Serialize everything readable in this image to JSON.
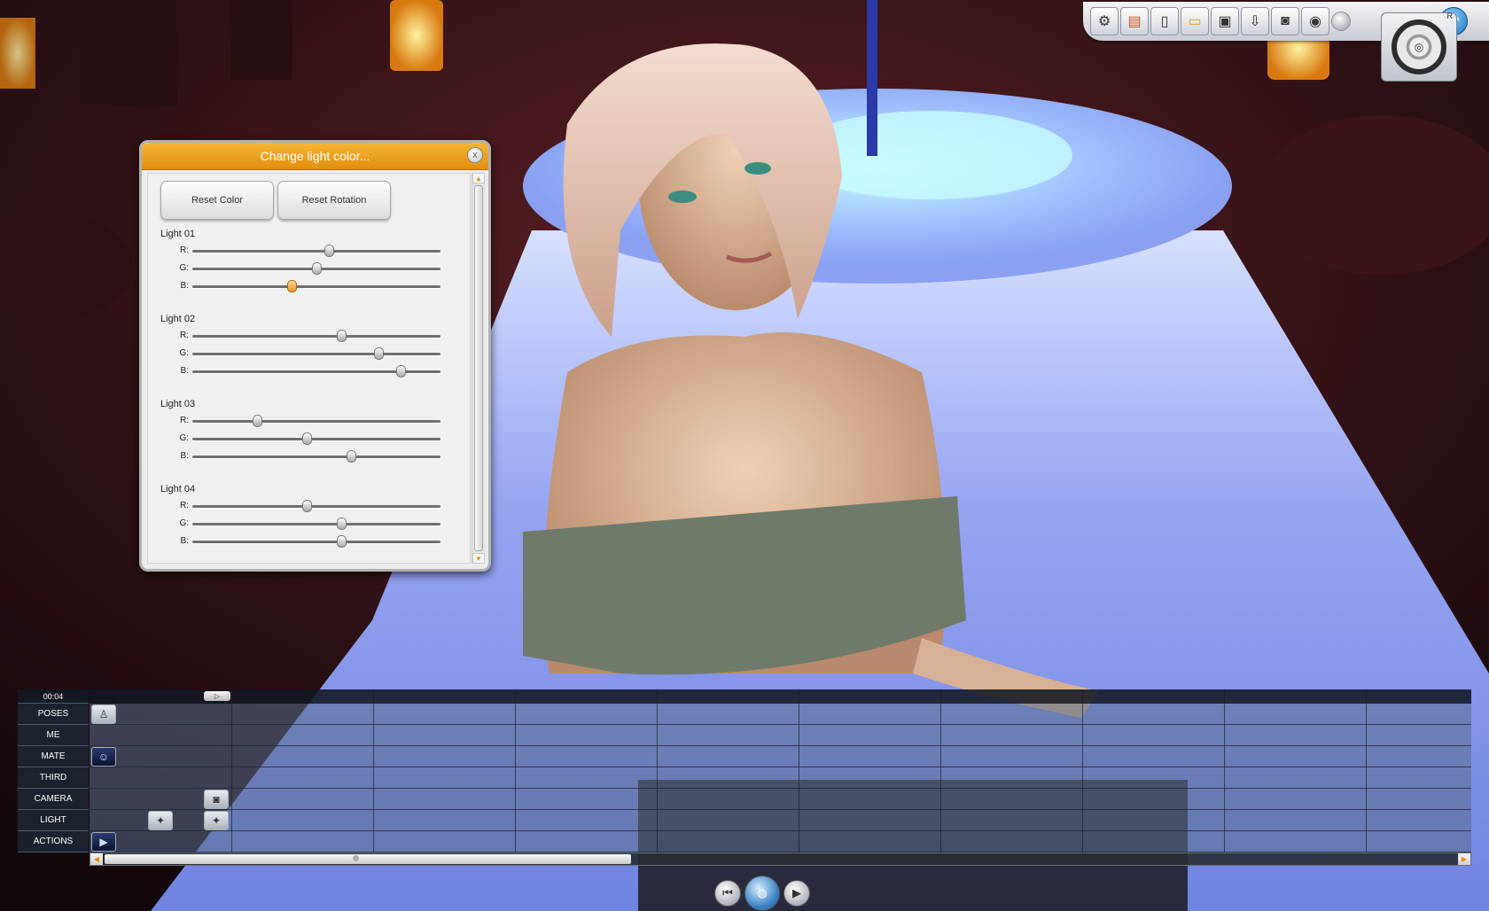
{
  "toolbar": {
    "buttons": [
      "tools-icon",
      "book-icon",
      "new-page-icon",
      "folder-icon",
      "save-icon",
      "download-icon",
      "camera-icon",
      "film-icon",
      "settings-icon",
      "undo-icon"
    ]
  },
  "nav_widget": {
    "label_r": "R"
  },
  "dialog": {
    "title": "Change light color...",
    "close_glyph": "x",
    "reset_color_label": "Reset Color",
    "reset_rotation_label": "Reset Rotation",
    "lights": [
      {
        "name": "Light 01",
        "channels": [
          {
            "label": "R:",
            "value": 0.55
          },
          {
            "label": "G:",
            "value": 0.5
          },
          {
            "label": "B:",
            "value": 0.4,
            "active": true
          }
        ]
      },
      {
        "name": "Light 02",
        "channels": [
          {
            "label": "R:",
            "value": 0.6
          },
          {
            "label": "G:",
            "value": 0.75
          },
          {
            "label": "B:",
            "value": 0.84
          }
        ]
      },
      {
        "name": "Light 03",
        "channels": [
          {
            "label": "R:",
            "value": 0.26
          },
          {
            "label": "G:",
            "value": 0.46
          },
          {
            "label": "B:",
            "value": 0.64
          }
        ]
      },
      {
        "name": "Light 04",
        "channels": [
          {
            "label": "R:",
            "value": 0.46
          },
          {
            "label": "G:",
            "value": 0.6
          },
          {
            "label": "B:",
            "value": 0.6
          }
        ]
      }
    ]
  },
  "timeline": {
    "time": "00:04",
    "rows": [
      "POSES",
      "ME",
      "MATE",
      "THIRD",
      "CAMERA",
      "LIGHT",
      "ACTIONS"
    ]
  },
  "colors": {
    "dialog_title": "#f0a325",
    "timeline_bg": "#4f6380"
  }
}
